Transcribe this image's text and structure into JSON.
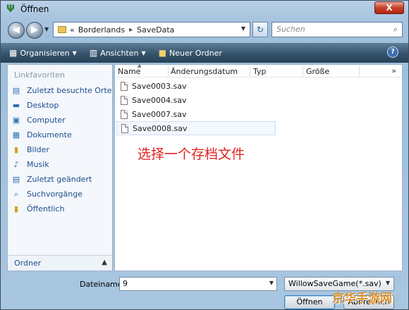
{
  "window": {
    "title": "Öffnen",
    "close_glyph": "X"
  },
  "address": {
    "prefix": "«",
    "crumbs": [
      "Borderlands",
      "SaveData"
    ],
    "search_placeholder": "Suchen"
  },
  "toolbar": {
    "organize": "Organisieren",
    "views": "Ansichten",
    "new_folder": "Neuer Ordner",
    "help": "?"
  },
  "sidebar": {
    "heading": "Linkfavoriten",
    "items": [
      {
        "label": "Zuletzt besuchte Orte",
        "icon": "recent-places-icon",
        "glyph": "▤",
        "color": "blue"
      },
      {
        "label": "Desktop",
        "icon": "desktop-icon",
        "glyph": "▬",
        "color": "blue"
      },
      {
        "label": "Computer",
        "icon": "computer-icon",
        "glyph": "▣",
        "color": "blue"
      },
      {
        "label": "Dokumente",
        "icon": "documents-icon",
        "glyph": "▦",
        "color": "blue"
      },
      {
        "label": "Bilder",
        "icon": "pictures-folder-icon",
        "glyph": "▮",
        "color": "yellow"
      },
      {
        "label": "Musik",
        "icon": "music-icon",
        "glyph": "♪",
        "color": "blue"
      },
      {
        "label": "Zuletzt geändert",
        "icon": "recently-changed-icon",
        "glyph": "▤",
        "color": "blue"
      },
      {
        "label": "Suchvorgänge",
        "icon": "searches-icon",
        "glyph": "⌕",
        "color": "blue"
      },
      {
        "label": "Öffentlich",
        "icon": "public-folder-icon",
        "glyph": "▮",
        "color": "yellow"
      }
    ],
    "footer": "Ordner"
  },
  "filelist": {
    "columns": [
      "Name",
      "Änderungsdatum",
      "Typ",
      "Größe"
    ],
    "more": "»",
    "files": [
      "Save0003.sav",
      "Save0004.sav",
      "Save0007.sav",
      "Save0008.sav"
    ]
  },
  "annotation": "选择一个存档文件",
  "bottom": {
    "filename_label": "Dateiname:",
    "filename_value": "9",
    "filetype": "WillowSaveGame(*.sav)",
    "open": "Öffnen",
    "cancel": "Abbrechen"
  },
  "watermark": "京华手游网"
}
